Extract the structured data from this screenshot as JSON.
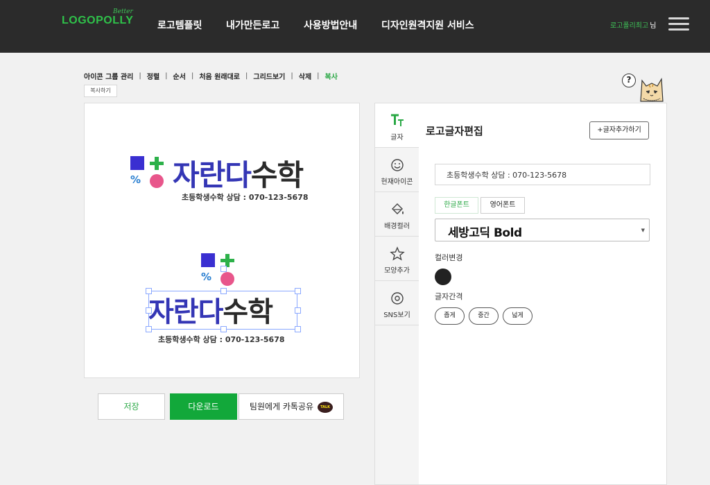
{
  "header": {
    "logo": "LOGOPOLLY",
    "logo_super": "Better",
    "nav": [
      "로고템플릿",
      "내가만든로고",
      "사용방법안내",
      "디자인원격지원 서비스"
    ],
    "user_name": "로고폴리최고",
    "user_suffix": "님",
    "menu_icon": "hamburger-icon"
  },
  "toolbar": {
    "items": [
      "아이콘 그룹 관리",
      "정렬",
      "순서",
      "처음 원래대로",
      "그리드보기",
      "삭제",
      "복사"
    ],
    "active_item": "복사",
    "copy_button": "복사하기"
  },
  "canvas": {
    "logo_title_blue": "자란다",
    "logo_title_dark": "수학",
    "logo_symbol": "%",
    "tagline": "초등학생수학 상담 : 070-123-5678"
  },
  "actions": {
    "save": "저장",
    "download": "다운로드",
    "kakao_share": "팀원에게 카톡공유",
    "talk_badge": "TALK"
  },
  "help": {
    "label": "?"
  },
  "sidebar": {
    "tabs": [
      {
        "label": "글자",
        "icon": "text-icon",
        "active": true
      },
      {
        "label": "현재아이콘",
        "icon": "smiley-icon",
        "active": false
      },
      {
        "label": "배경컬러",
        "icon": "paint-bucket-icon",
        "active": false
      },
      {
        "label": "모양추가",
        "icon": "star-icon",
        "active": false
      },
      {
        "label": "SNS보기",
        "icon": "at-sign-icon",
        "active": false
      }
    ]
  },
  "editor": {
    "title": "로고글자편집",
    "add_text": "+글자추가하기",
    "text_value": "초등학생수학 상담 : 070-123-5678",
    "font_tabs": [
      "한글폰트",
      "영어폰트"
    ],
    "font_name": "세방고딕 Bold",
    "color_label": "컬러변경",
    "color_value": "#222222",
    "spacing_label": "글자간격",
    "spacing_options": [
      "좁게",
      "중간",
      "넓게"
    ]
  },
  "colors": {
    "header_bg": "#2b2b2b",
    "accent_green": "#12a83a",
    "logo_blue": "#3436b5",
    "logo_pink": "#e8568b"
  }
}
